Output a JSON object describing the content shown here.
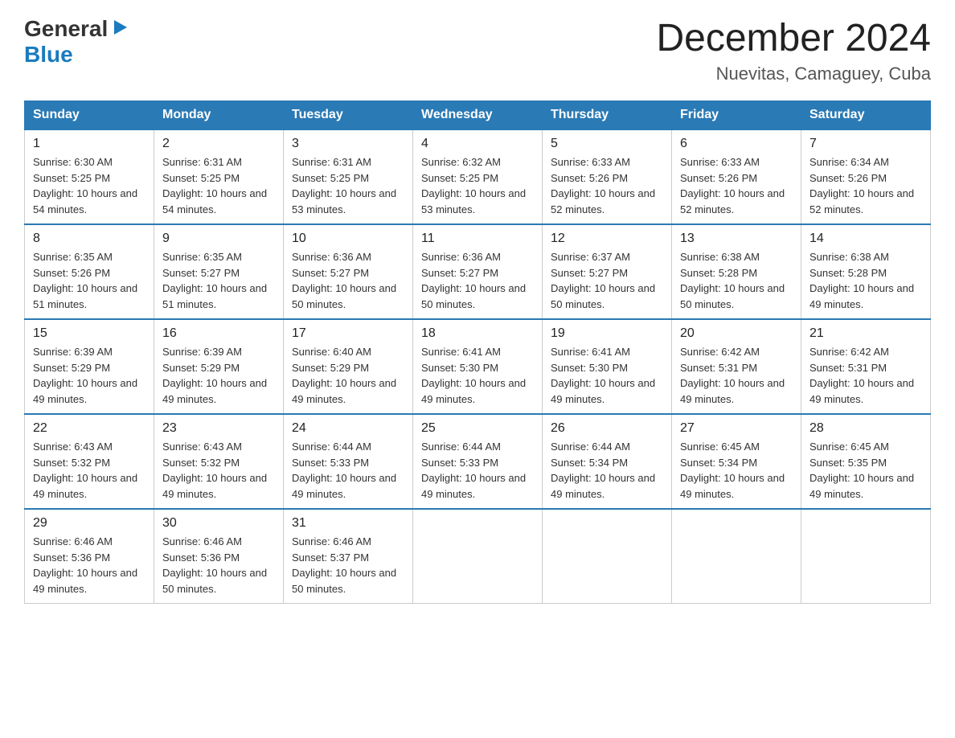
{
  "header": {
    "logo_general": "General",
    "logo_blue": "Blue",
    "month_title": "December 2024",
    "location": "Nuevitas, Camaguey, Cuba"
  },
  "weekdays": [
    "Sunday",
    "Monday",
    "Tuesday",
    "Wednesday",
    "Thursday",
    "Friday",
    "Saturday"
  ],
  "weeks": [
    [
      {
        "day": "1",
        "sunrise": "6:30 AM",
        "sunset": "5:25 PM",
        "daylight": "10 hours and 54 minutes."
      },
      {
        "day": "2",
        "sunrise": "6:31 AM",
        "sunset": "5:25 PM",
        "daylight": "10 hours and 54 minutes."
      },
      {
        "day": "3",
        "sunrise": "6:31 AM",
        "sunset": "5:25 PM",
        "daylight": "10 hours and 53 minutes."
      },
      {
        "day": "4",
        "sunrise": "6:32 AM",
        "sunset": "5:25 PM",
        "daylight": "10 hours and 53 minutes."
      },
      {
        "day": "5",
        "sunrise": "6:33 AM",
        "sunset": "5:26 PM",
        "daylight": "10 hours and 52 minutes."
      },
      {
        "day": "6",
        "sunrise": "6:33 AM",
        "sunset": "5:26 PM",
        "daylight": "10 hours and 52 minutes."
      },
      {
        "day": "7",
        "sunrise": "6:34 AM",
        "sunset": "5:26 PM",
        "daylight": "10 hours and 52 minutes."
      }
    ],
    [
      {
        "day": "8",
        "sunrise": "6:35 AM",
        "sunset": "5:26 PM",
        "daylight": "10 hours and 51 minutes."
      },
      {
        "day": "9",
        "sunrise": "6:35 AM",
        "sunset": "5:27 PM",
        "daylight": "10 hours and 51 minutes."
      },
      {
        "day": "10",
        "sunrise": "6:36 AM",
        "sunset": "5:27 PM",
        "daylight": "10 hours and 50 minutes."
      },
      {
        "day": "11",
        "sunrise": "6:36 AM",
        "sunset": "5:27 PM",
        "daylight": "10 hours and 50 minutes."
      },
      {
        "day": "12",
        "sunrise": "6:37 AM",
        "sunset": "5:27 PM",
        "daylight": "10 hours and 50 minutes."
      },
      {
        "day": "13",
        "sunrise": "6:38 AM",
        "sunset": "5:28 PM",
        "daylight": "10 hours and 50 minutes."
      },
      {
        "day": "14",
        "sunrise": "6:38 AM",
        "sunset": "5:28 PM",
        "daylight": "10 hours and 49 minutes."
      }
    ],
    [
      {
        "day": "15",
        "sunrise": "6:39 AM",
        "sunset": "5:29 PM",
        "daylight": "10 hours and 49 minutes."
      },
      {
        "day": "16",
        "sunrise": "6:39 AM",
        "sunset": "5:29 PM",
        "daylight": "10 hours and 49 minutes."
      },
      {
        "day": "17",
        "sunrise": "6:40 AM",
        "sunset": "5:29 PM",
        "daylight": "10 hours and 49 minutes."
      },
      {
        "day": "18",
        "sunrise": "6:41 AM",
        "sunset": "5:30 PM",
        "daylight": "10 hours and 49 minutes."
      },
      {
        "day": "19",
        "sunrise": "6:41 AM",
        "sunset": "5:30 PM",
        "daylight": "10 hours and 49 minutes."
      },
      {
        "day": "20",
        "sunrise": "6:42 AM",
        "sunset": "5:31 PM",
        "daylight": "10 hours and 49 minutes."
      },
      {
        "day": "21",
        "sunrise": "6:42 AM",
        "sunset": "5:31 PM",
        "daylight": "10 hours and 49 minutes."
      }
    ],
    [
      {
        "day": "22",
        "sunrise": "6:43 AM",
        "sunset": "5:32 PM",
        "daylight": "10 hours and 49 minutes."
      },
      {
        "day": "23",
        "sunrise": "6:43 AM",
        "sunset": "5:32 PM",
        "daylight": "10 hours and 49 minutes."
      },
      {
        "day": "24",
        "sunrise": "6:44 AM",
        "sunset": "5:33 PM",
        "daylight": "10 hours and 49 minutes."
      },
      {
        "day": "25",
        "sunrise": "6:44 AM",
        "sunset": "5:33 PM",
        "daylight": "10 hours and 49 minutes."
      },
      {
        "day": "26",
        "sunrise": "6:44 AM",
        "sunset": "5:34 PM",
        "daylight": "10 hours and 49 minutes."
      },
      {
        "day": "27",
        "sunrise": "6:45 AM",
        "sunset": "5:34 PM",
        "daylight": "10 hours and 49 minutes."
      },
      {
        "day": "28",
        "sunrise": "6:45 AM",
        "sunset": "5:35 PM",
        "daylight": "10 hours and 49 minutes."
      }
    ],
    [
      {
        "day": "29",
        "sunrise": "6:46 AM",
        "sunset": "5:36 PM",
        "daylight": "10 hours and 49 minutes."
      },
      {
        "day": "30",
        "sunrise": "6:46 AM",
        "sunset": "5:36 PM",
        "daylight": "10 hours and 50 minutes."
      },
      {
        "day": "31",
        "sunrise": "6:46 AM",
        "sunset": "5:37 PM",
        "daylight": "10 hours and 50 minutes."
      },
      null,
      null,
      null,
      null
    ]
  ],
  "labels": {
    "sunrise_prefix": "Sunrise: ",
    "sunset_prefix": "Sunset: ",
    "daylight_prefix": "Daylight: "
  }
}
